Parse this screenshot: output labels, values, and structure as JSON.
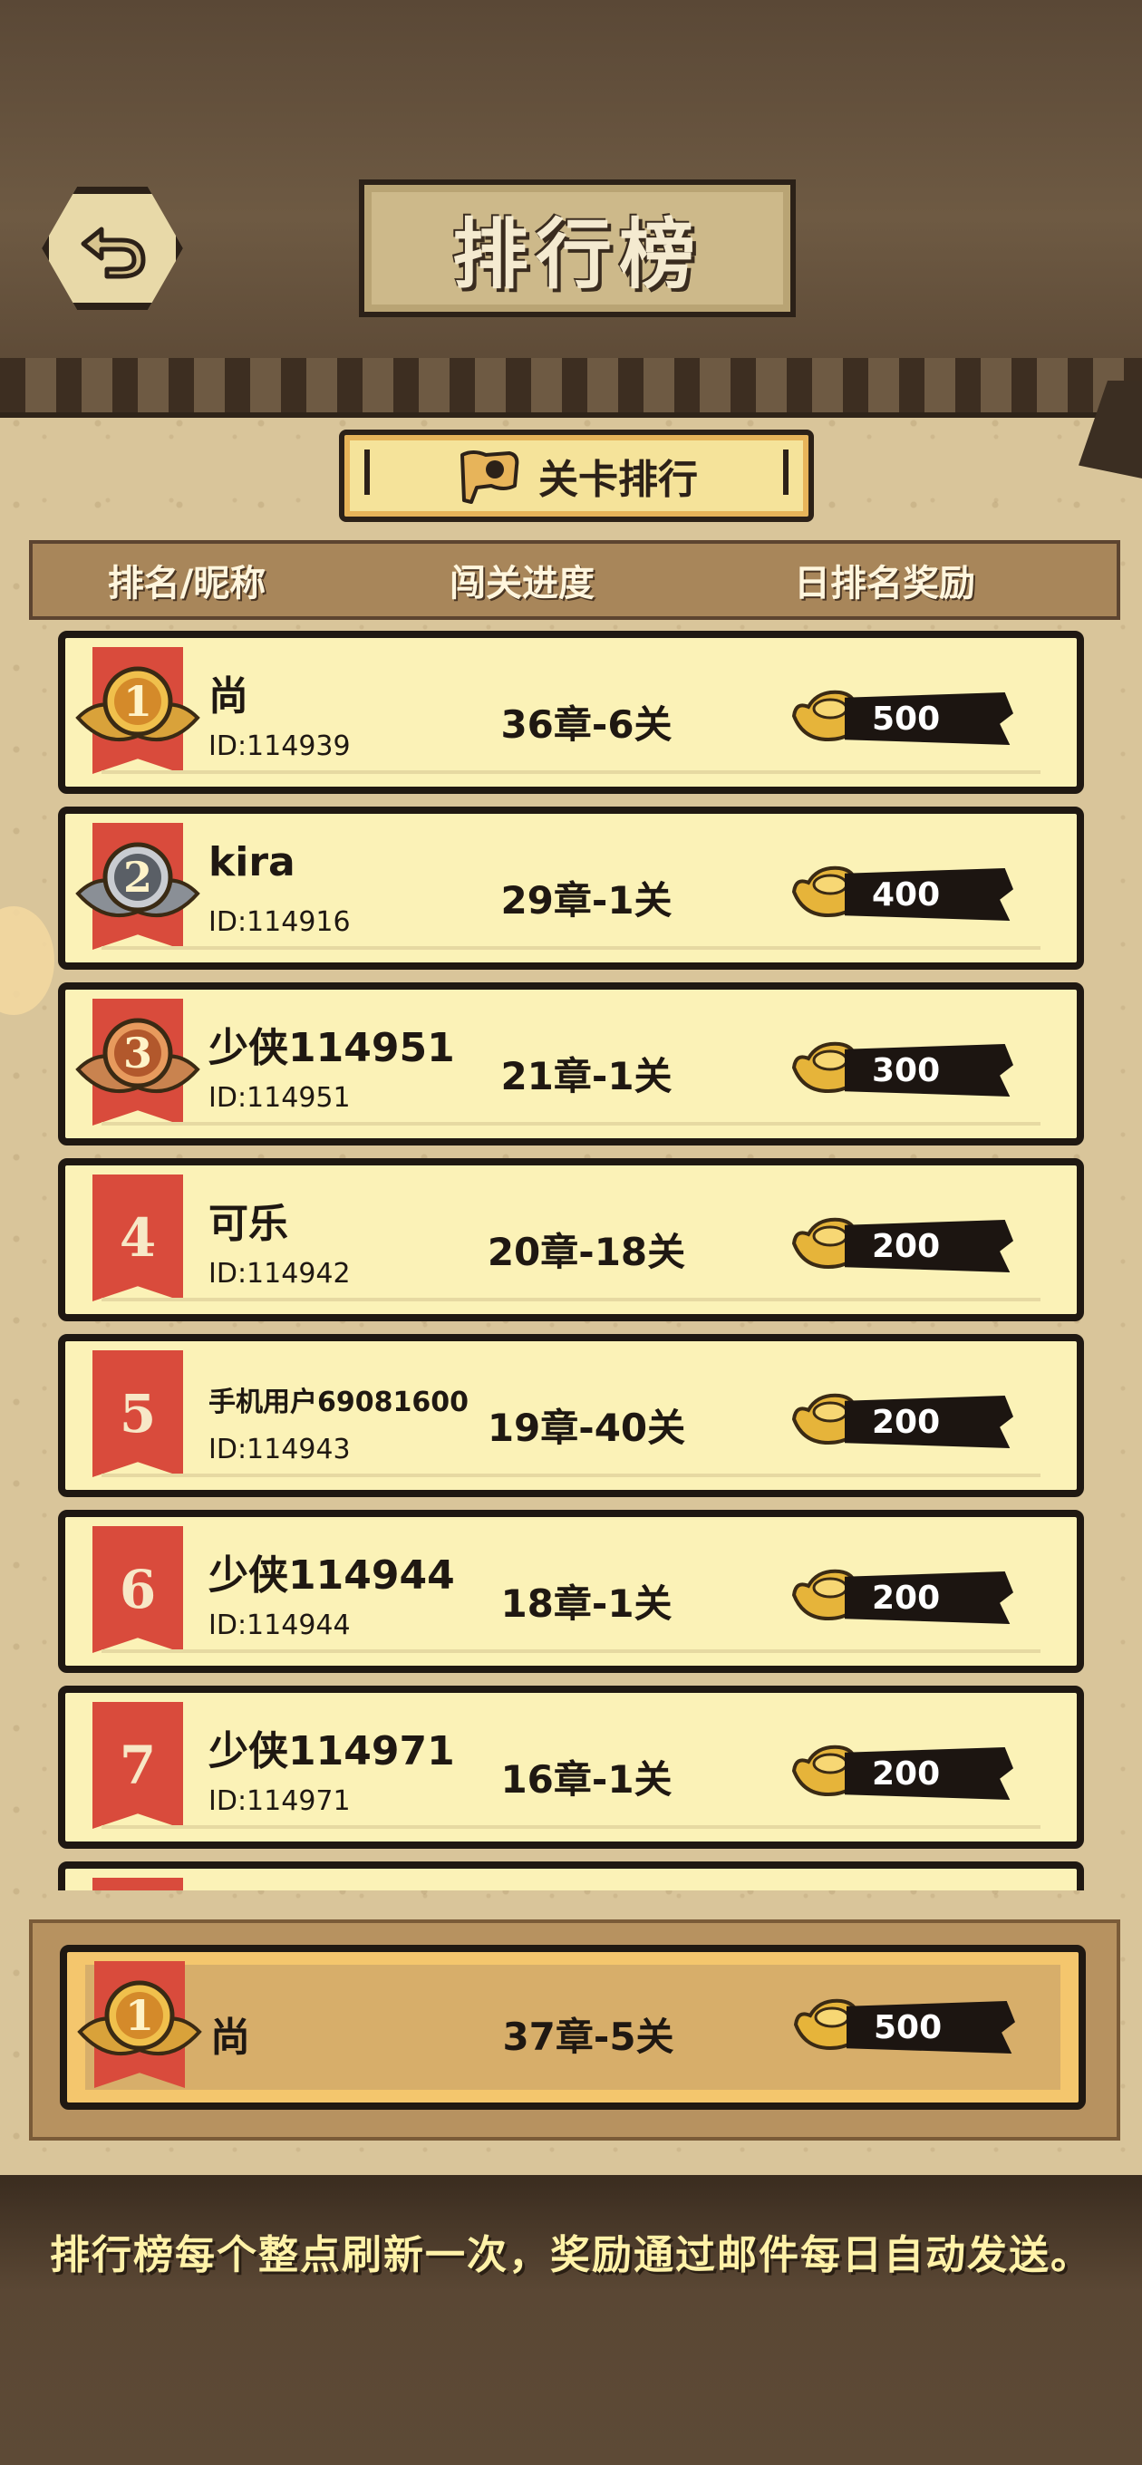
{
  "header": {
    "title": "排行榜",
    "tab_label": "关卡排行"
  },
  "columns": {
    "rank_name": "排名/昵称",
    "progress": "闯关进度",
    "daily_reward": "日排名奖励"
  },
  "rows": [
    {
      "rank": "1",
      "name": "尚",
      "id": "ID:114939",
      "progress": "36章-6关",
      "reward": "500",
      "medal": "gold-medal"
    },
    {
      "rank": "2",
      "name": "kira",
      "id": "ID:114916",
      "progress": "29章-1关",
      "reward": "400",
      "medal": "silver-medal"
    },
    {
      "rank": "3",
      "name": "少侠114951",
      "id": "ID:114951",
      "progress": "21章-1关",
      "reward": "300",
      "medal": "bronze-medal"
    },
    {
      "rank": "4",
      "name": "可乐",
      "id": "ID:114942",
      "progress": "20章-18关",
      "reward": "200"
    },
    {
      "rank": "5",
      "name": "手机用户69081600",
      "id": "ID:114943",
      "progress": "19章-40关",
      "reward": "200"
    },
    {
      "rank": "6",
      "name": "少侠114944",
      "id": "ID:114944",
      "progress": "18章-1关",
      "reward": "200"
    },
    {
      "rank": "7",
      "name": "少侠114971",
      "id": "ID:114971",
      "progress": "16章-1关",
      "reward": "200"
    }
  ],
  "my_rank": {
    "rank": "1",
    "name": "尚",
    "progress": "37章-5关",
    "reward": "500",
    "medal": "gold-medal"
  },
  "footer_notice": "排行榜每个整点刷新一次，奖励通过邮件每日自动发送。",
  "colors": {
    "background": "#5d4a36",
    "parchment": "#d9c59a",
    "row": "#fbf2b7",
    "rank_banner": "#d94b3c",
    "gold": "#e6b43a",
    "notice_text": "#fff2a8"
  }
}
